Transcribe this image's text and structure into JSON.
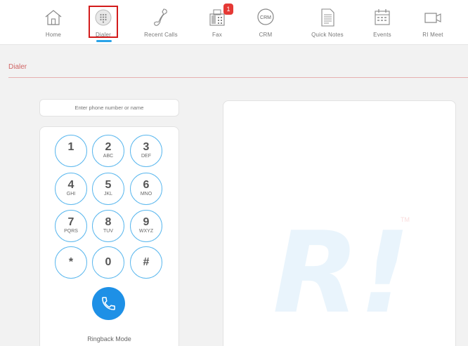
{
  "nav": {
    "items": [
      {
        "label": "Home",
        "icon": "home-icon"
      },
      {
        "label": "Dialer",
        "icon": "dialpad-icon"
      },
      {
        "label": "Recent Calls",
        "icon": "phone-handset-icon"
      },
      {
        "label": "Fax",
        "icon": "fax-icon"
      },
      {
        "label": "CRM",
        "icon": "crm-icon"
      },
      {
        "label": "Quick Notes",
        "icon": "notes-icon"
      },
      {
        "label": "Events",
        "icon": "calendar-icon"
      },
      {
        "label": "RI Meet",
        "icon": "video-icon"
      }
    ],
    "fax_badge": "1",
    "crm_icon_text": "CRM",
    "active": "Dialer"
  },
  "section": {
    "title": "Dialer"
  },
  "dialer": {
    "input_placeholder": "Enter phone number or name",
    "keys": [
      {
        "digit": "1",
        "letters": ""
      },
      {
        "digit": "2",
        "letters": "ABC"
      },
      {
        "digit": "3",
        "letters": "DEF"
      },
      {
        "digit": "4",
        "letters": "GHI"
      },
      {
        "digit": "5",
        "letters": "JKL"
      },
      {
        "digit": "6",
        "letters": "MNO"
      },
      {
        "digit": "7",
        "letters": "PQRS"
      },
      {
        "digit": "8",
        "letters": "TUV"
      },
      {
        "digit": "9",
        "letters": "WXYZ"
      },
      {
        "digit": "*",
        "letters": ""
      },
      {
        "digit": "0",
        "letters": ""
      },
      {
        "digit": "#",
        "letters": ""
      }
    ],
    "call_icon": "phone-call-icon",
    "ringback_label": "Ringback Mode"
  },
  "logo": {
    "letters": "R!",
    "trademark": "TM"
  },
  "colors": {
    "accent": "#1e90e6",
    "key_border": "#5cb8ee",
    "highlight": "#d31b1b",
    "badge": "#e53935",
    "section_title": "#d06565"
  }
}
